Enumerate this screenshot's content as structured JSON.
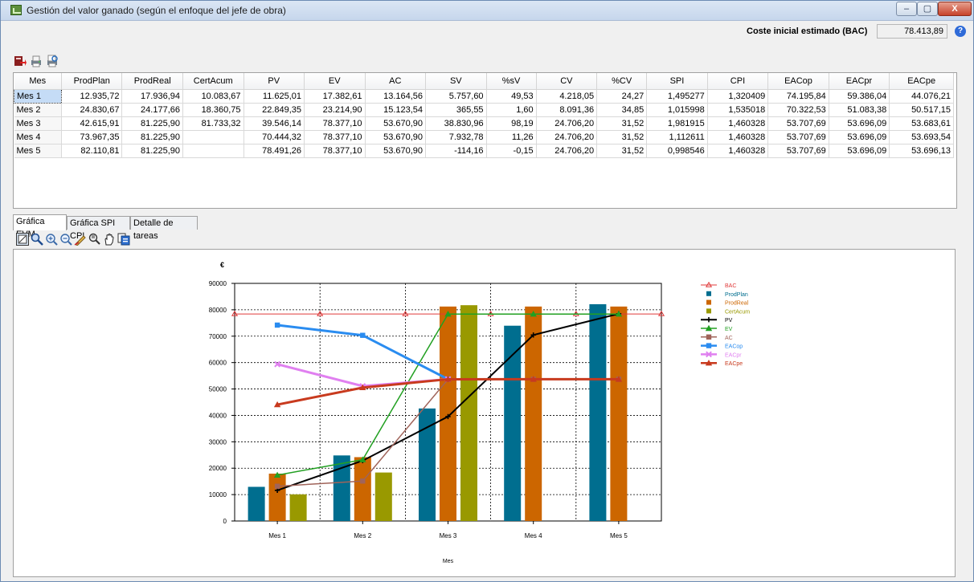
{
  "window": {
    "title": "Gestión del valor ganado (según el enfoque del jefe de obra)",
    "controls": {
      "minimize": "–",
      "maximize": "▢",
      "close": "X"
    }
  },
  "bac": {
    "label": "Coste inicial estimado (BAC)",
    "value": "78.413,89"
  },
  "toolbar_icons": [
    "export-icon",
    "print-icon",
    "print-preview-icon"
  ],
  "table": {
    "headers": [
      "Mes",
      "ProdPlan",
      "ProdReal",
      "CertAcum",
      "PV",
      "EV",
      "AC",
      "SV",
      "%sV",
      "CV",
      "%CV",
      "SPI",
      "CPI",
      "EACop",
      "EACpr",
      "EACpe"
    ],
    "rows": [
      [
        "Mes 1",
        "12.935,72",
        "17.936,94",
        "10.083,67",
        "11.625,01",
        "17.382,61",
        "13.164,56",
        "5.757,60",
        "49,53",
        "4.218,05",
        "24,27",
        "1,495277",
        "1,320409",
        "74.195,84",
        "59.386,04",
        "44.076,21"
      ],
      [
        "Mes 2",
        "24.830,67",
        "24.177,66",
        "18.360,75",
        "22.849,35",
        "23.214,90",
        "15.123,54",
        "365,55",
        "1,60",
        "8.091,36",
        "34,85",
        "1,015998",
        "1,535018",
        "70.322,53",
        "51.083,38",
        "50.517,15"
      ],
      [
        "Mes 3",
        "42.615,91",
        "81.225,90",
        "81.733,32",
        "39.546,14",
        "78.377,10",
        "53.670,90",
        "38.830,96",
        "98,19",
        "24.706,20",
        "31,52",
        "1,981915",
        "1,460328",
        "53.707,69",
        "53.696,09",
        "53.683,61"
      ],
      [
        "Mes 4",
        "73.967,35",
        "81.225,90",
        "",
        "70.444,32",
        "78.377,10",
        "53.670,90",
        "7.932,78",
        "11,26",
        "24.706,20",
        "31,52",
        "1,112611",
        "1,460328",
        "53.707,69",
        "53.696,09",
        "53.693,54"
      ],
      [
        "Mes 5",
        "82.110,81",
        "81.225,90",
        "",
        "78.491,26",
        "78.377,10",
        "53.670,90",
        "-114,16",
        "-0,15",
        "24.706,20",
        "31,52",
        "0,998546",
        "1,460328",
        "53.707,69",
        "53.696,09",
        "53.696,13"
      ]
    ],
    "selected_row": 0
  },
  "tabs": [
    {
      "label": "Gráfica EVM",
      "active": true
    },
    {
      "label": "Gráfica SPI CPI",
      "active": false
    },
    {
      "label": "Detalle de tareas",
      "active": false
    }
  ],
  "chart_toolbar_icons": [
    "select-icon",
    "zoom-icon",
    "zoom-in-icon",
    "zoom-out-icon",
    "draw-icon",
    "find-icon",
    "pan-icon",
    "copy-icon"
  ],
  "chart_data": {
    "type": "bar",
    "ylabel": "€",
    "xlabel": "Mes",
    "categories": [
      "Mes 1",
      "Mes 2",
      "Mes 3",
      "Mes 4",
      "Mes 5"
    ],
    "ylim": [
      0,
      90000
    ],
    "yticks": [
      0,
      10000,
      20000,
      30000,
      40000,
      50000,
      60000,
      70000,
      80000,
      90000
    ],
    "grid": true,
    "legend_position": "right",
    "bar_series": [
      {
        "name": "ProdPlan",
        "color": "#006e8f",
        "values": [
          12935.72,
          24830.67,
          42615.91,
          73967.35,
          82110.81
        ]
      },
      {
        "name": "ProdReal",
        "color": "#cc6600",
        "values": [
          17936.94,
          24177.66,
          81225.9,
          81225.9,
          81225.9
        ]
      },
      {
        "name": "CertAcum",
        "color": "#999900",
        "values": [
          10083.67,
          18360.75,
          81733.32,
          null,
          null
        ]
      }
    ],
    "line_series": [
      {
        "name": "BAC",
        "color": "#e03a3a",
        "marker": "triangle-open",
        "width": 1,
        "values": [
          78413.89,
          78413.89,
          78413.89,
          78413.89,
          78413.89
        ]
      },
      {
        "name": "PV",
        "color": "#000000",
        "marker": "plus",
        "width": 2,
        "values": [
          11625.01,
          22849.35,
          39546.14,
          70444.32,
          78491.26
        ]
      },
      {
        "name": "EV",
        "color": "#22a022",
        "marker": "triangle",
        "width": 1.5,
        "values": [
          17382.61,
          23214.9,
          78377.1,
          78377.1,
          78377.1
        ]
      },
      {
        "name": "AC",
        "color": "#a0645a",
        "marker": "square",
        "width": 1.5,
        "values": [
          13164.56,
          15123.54,
          53670.9,
          53670.9,
          53670.9
        ]
      },
      {
        "name": "EACop",
        "color": "#2a8cf0",
        "marker": "square",
        "width": 3,
        "values": [
          74195.84,
          70322.53,
          53707.69,
          null,
          null
        ]
      },
      {
        "name": "EACpr",
        "color": "#e080f0",
        "marker": "cross",
        "width": 3,
        "values": [
          59386.04,
          51083.38,
          53696.09,
          null,
          null
        ]
      },
      {
        "name": "EACpe",
        "color": "#c83a1e",
        "marker": "triangle",
        "width": 3,
        "values": [
          44076.21,
          50517.15,
          53683.61,
          53693.54,
          53696.13
        ]
      }
    ],
    "legend_order": [
      "BAC",
      "ProdPlan",
      "ProdReal",
      "CertAcum",
      "PV",
      "EV",
      "AC",
      "EACop",
      "EACpr",
      "EACpe"
    ]
  }
}
